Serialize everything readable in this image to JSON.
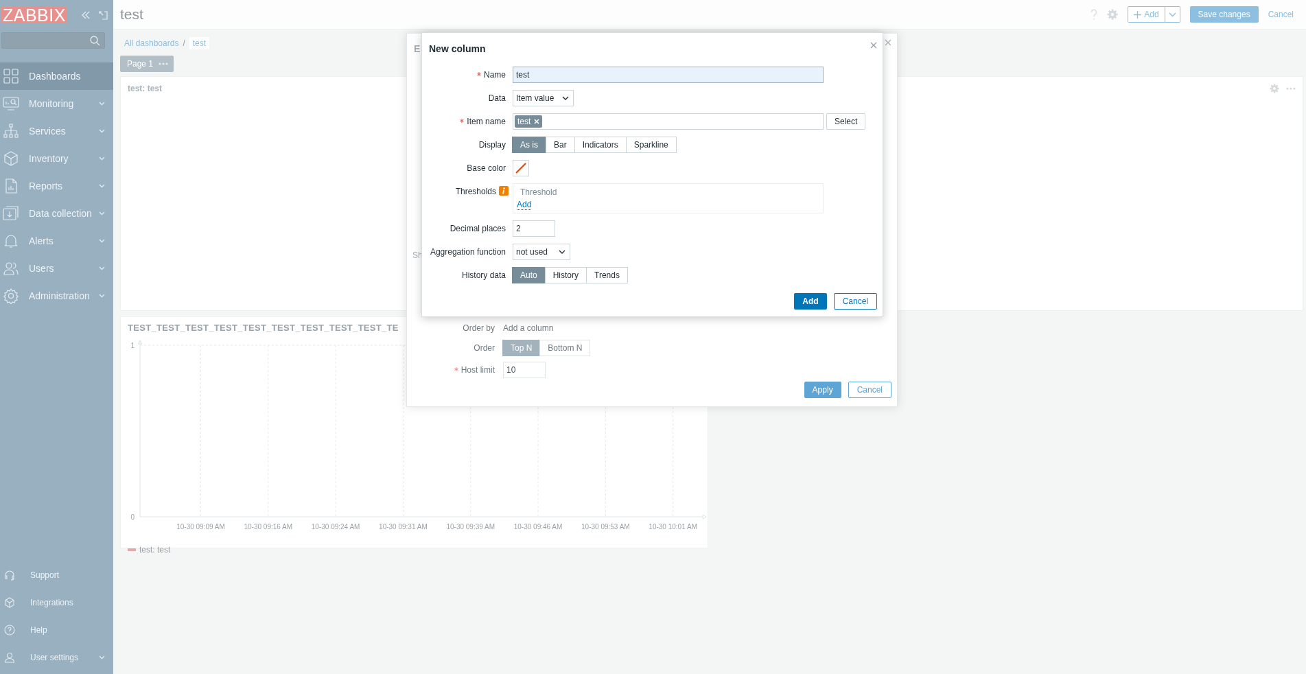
{
  "sidebar": {
    "logo": "ZABBIX",
    "items": [
      {
        "label": "Dashboards",
        "selected": true,
        "submenu": false
      },
      {
        "label": "Monitoring",
        "selected": false,
        "submenu": true
      },
      {
        "label": "Services",
        "selected": false,
        "submenu": true
      },
      {
        "label": "Inventory",
        "selected": false,
        "submenu": true
      },
      {
        "label": "Reports",
        "selected": false,
        "submenu": true
      },
      {
        "label": "Data collection",
        "selected": false,
        "submenu": true
      },
      {
        "label": "Alerts",
        "selected": false,
        "submenu": true
      },
      {
        "label": "Users",
        "selected": false,
        "submenu": true
      },
      {
        "label": "Administration",
        "selected": false,
        "submenu": true
      }
    ],
    "bottom_items": [
      {
        "label": "Support",
        "submenu": false
      },
      {
        "label": "Integrations",
        "submenu": false
      },
      {
        "label": "Help",
        "submenu": false
      },
      {
        "label": "User settings",
        "submenu": true
      }
    ]
  },
  "header": {
    "title": "test",
    "add_button": "Add",
    "save_button": "Save changes",
    "cancel_link": "Cancel"
  },
  "breadcrumb_separator": "/",
  "breadcrumbs": [
    {
      "label": "All dashboards",
      "current": false
    },
    {
      "label": "test",
      "current": true
    }
  ],
  "page_tabs": [
    {
      "label": "Page 1",
      "selected": true
    }
  ],
  "widgets": [
    {
      "title": "test: test"
    },
    {
      "title": "TEST_TEST_TEST_TEST_TEST_TEST_TEST_TEST_TEST_TE",
      "chart_data": {
        "type": "line",
        "grid": true,
        "categories": [
          "10-30 09:09 AM",
          "10-30 09:16 AM",
          "10-30 09:24 AM",
          "10-30 09:31 AM",
          "10-30 09:39 AM",
          "10-30 09:46 AM",
          "10-30 09:53 AM",
          "10-30 10:01 AM"
        ],
        "ylim": [
          0,
          1
        ],
        "yticks": [
          0,
          1
        ],
        "series": [
          {
            "name": "test: test",
            "color": "#e2a9a9",
            "values": [
              null,
              null,
              null,
              null,
              null,
              null,
              null,
              null
            ]
          }
        ]
      }
    }
  ],
  "edit_dialog": {
    "title": "E",
    "show_label": "Sh",
    "order_by": {
      "label": "Order by",
      "value": "Add a column"
    },
    "order": {
      "label": "Order",
      "options": [
        {
          "label": "Top N",
          "selected": true
        },
        {
          "label": "Bottom N",
          "selected": false
        }
      ]
    },
    "host_limit": {
      "label": "Host limit",
      "required": true,
      "value": "10"
    },
    "buttons": {
      "apply": "Apply",
      "cancel": "Cancel"
    }
  },
  "new_column_dialog": {
    "title": "New column",
    "rows": [
      {
        "kind": "text",
        "label": "Name",
        "required": true,
        "value": "test"
      },
      {
        "kind": "select",
        "label": "Data",
        "required": false,
        "value": "Item value"
      },
      {
        "kind": "multiselect",
        "label": "Item name",
        "required": true,
        "tags": [
          "test"
        ],
        "button": "Select"
      },
      {
        "kind": "segmented",
        "label": "Display",
        "required": false,
        "options": [
          {
            "label": "As is",
            "selected": true
          },
          {
            "label": "Bar",
            "selected": false
          },
          {
            "label": "Indicators",
            "selected": false
          },
          {
            "label": "Sparkline",
            "selected": false
          }
        ]
      },
      {
        "kind": "color",
        "label": "Base color",
        "required": false
      },
      {
        "kind": "thresholds",
        "label": "Thresholds",
        "required": false,
        "header": "Threshold",
        "add_link": "Add"
      },
      {
        "kind": "number",
        "label": "Decimal places",
        "required": false,
        "value": "2"
      },
      {
        "kind": "select",
        "label": "Aggregation function",
        "required": false,
        "value": "not used"
      },
      {
        "kind": "segmented",
        "label": "History data",
        "required": false,
        "options": [
          {
            "label": "Auto",
            "selected": true
          },
          {
            "label": "History",
            "selected": false
          },
          {
            "label": "Trends",
            "selected": false
          }
        ]
      }
    ],
    "buttons": {
      "add": "Add",
      "cancel": "Cancel"
    }
  }
}
